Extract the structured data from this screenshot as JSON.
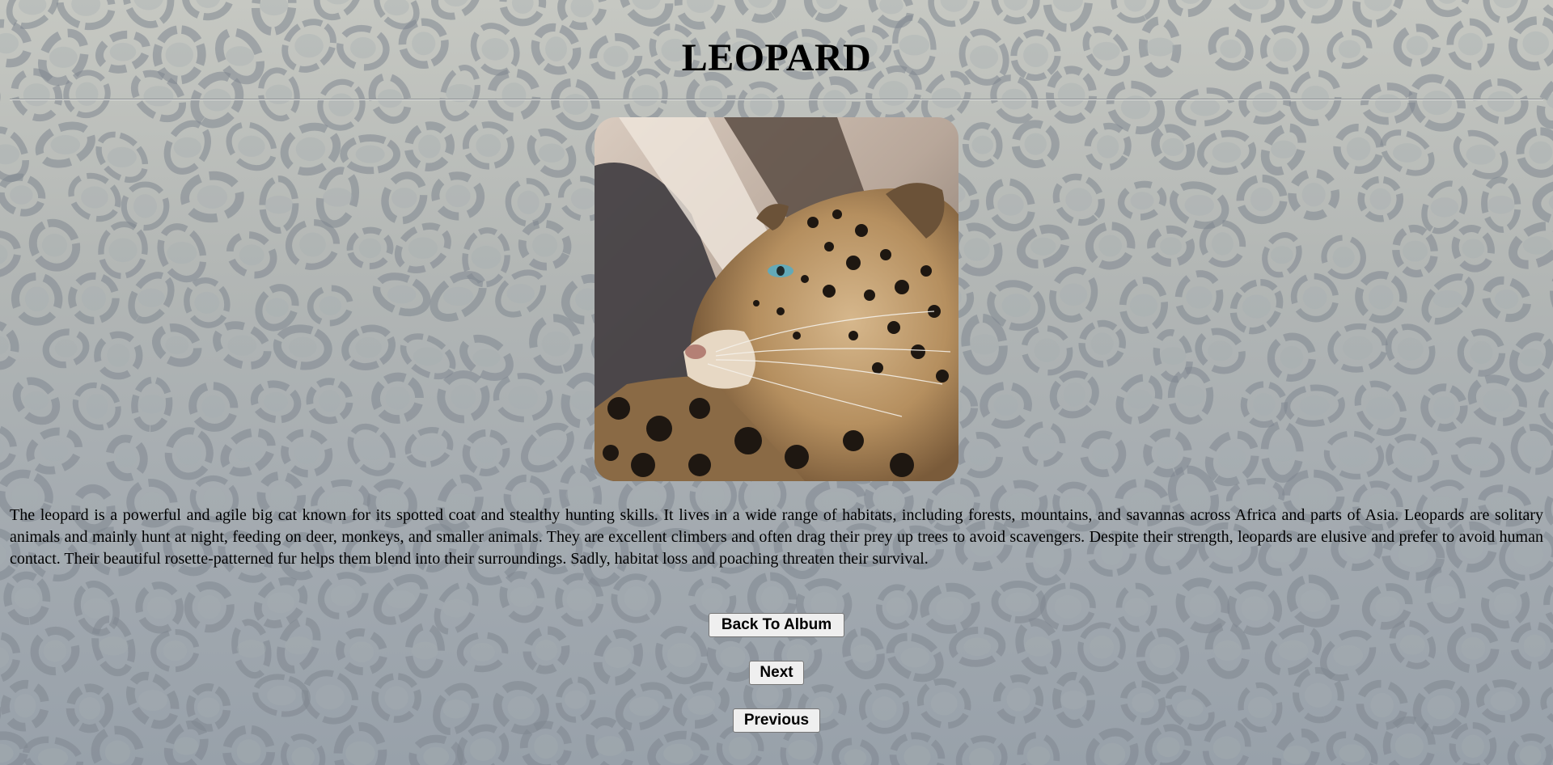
{
  "page": {
    "title": "LEOPARD",
    "image_alt": "leopard-photo",
    "description": "The leopard is a powerful and agile big cat known for its spotted coat and stealthy hunting skills. It lives in a wide range of habitats, including forests, mountains, and savannas across Africa and parts of Asia. Leopards are solitary animals and mainly hunt at night, feeding on deer, monkeys, and smaller animals. They are excellent climbers and often drag their prey up trees to avoid scavengers. Despite their strength, leopards are elusive and prefer to avoid human contact. Their beautiful rosette-patterned fur helps them blend into their surroundings. Sadly, habitat loss and poaching threaten their survival."
  },
  "buttons": {
    "back": "Back To Album",
    "next": "Next",
    "previous": "Previous"
  },
  "colors": {
    "background_top": "#c6c8c2",
    "background_bottom": "#98a1aa",
    "spot": "#7f8790",
    "spot_inner": "#a6aeb3",
    "button_bg": "#efefef"
  }
}
